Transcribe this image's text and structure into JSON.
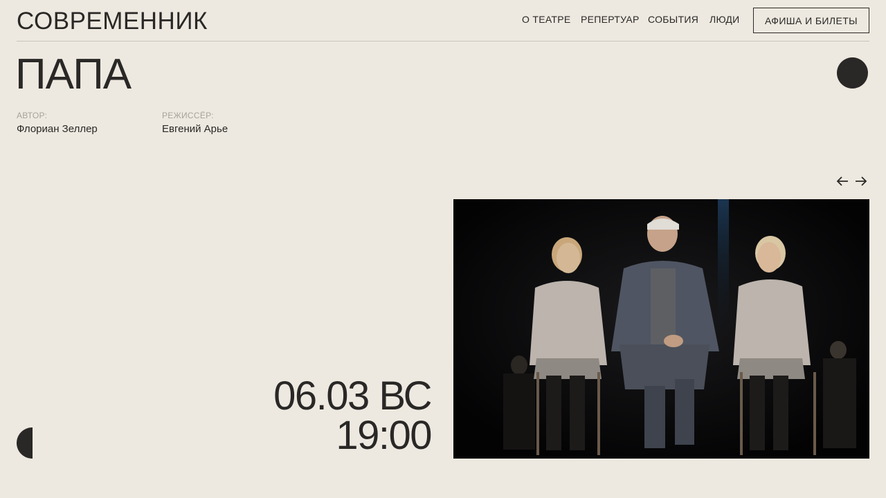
{
  "header": {
    "logo": "СОВРЕМЕННИК",
    "nav": [
      "О ТЕАТРЕ",
      "РЕПЕРТУАР",
      "СОБЫТИЯ",
      "ЛЮДИ"
    ],
    "tickets_label": "АФИША И БИЛЕТЫ"
  },
  "play": {
    "title": "ПАПА",
    "author_label": "АВТОР:",
    "author": "Флориан Зеллер",
    "director_label": "РЕЖИССЁР:",
    "director": "Евгений Арье"
  },
  "performance": {
    "date": "06.03 ВС",
    "time": "19:00"
  },
  "icons": {
    "prev": "arrow-left-icon",
    "next": "arrow-right-icon"
  },
  "colors": {
    "background": "#ede9e0",
    "text": "#2a2826",
    "muted": "#a8a39a"
  }
}
